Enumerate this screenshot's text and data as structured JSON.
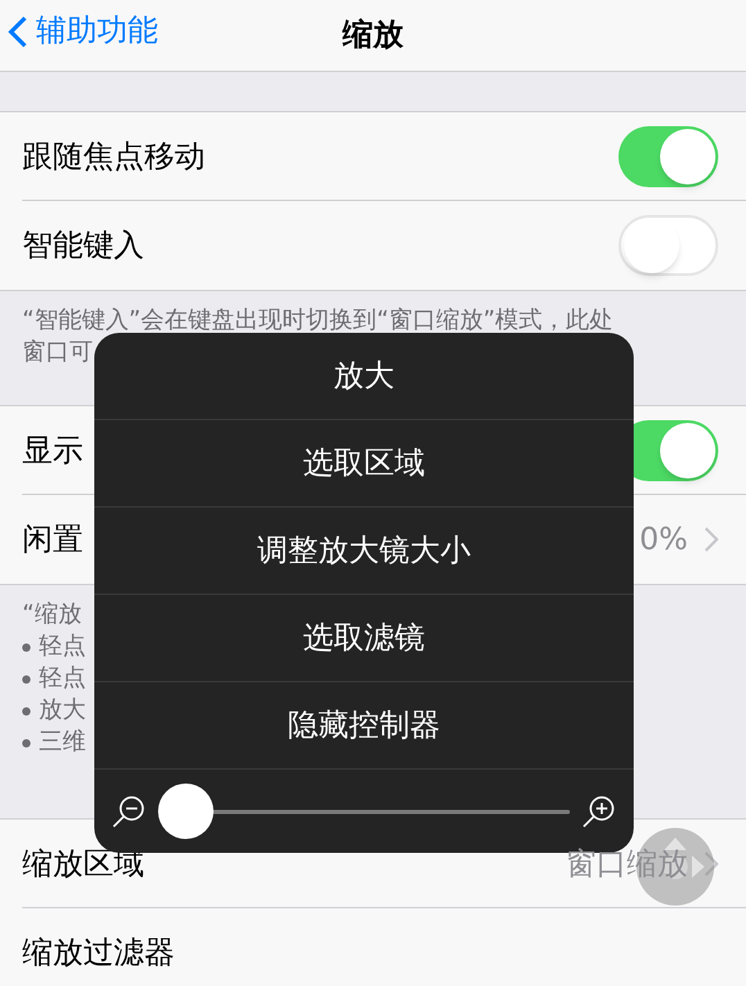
{
  "nav": {
    "back": "辅助功能",
    "title": "缩放"
  },
  "groups": [
    {
      "rows": [
        {
          "kind": "toggle",
          "label": "跟随焦点移动",
          "on": true
        },
        {
          "kind": "toggle",
          "label": "智能键入",
          "on": false
        }
      ],
      "footer": {
        "text": "“智能键入”会在键盘出现时切换到“窗口缩放”模式，此处",
        "lines": [
          "窗口可"
        ]
      }
    },
    {
      "rows": [
        {
          "kind": "toggle",
          "label": "显示",
          "on": true
        },
        {
          "kind": "value",
          "label": "闲置",
          "value": "0%"
        }
      ],
      "footer": {
        "text": "“缩放",
        "bullets": [
          "轻点",
          "轻点",
          "放大",
          "三维"
        ]
      }
    },
    {
      "rows": [
        {
          "kind": "value",
          "label": "缩放区域",
          "value": "窗口缩放"
        },
        {
          "kind": "plain",
          "label": "缩放过滤器"
        }
      ]
    }
  ],
  "menu": {
    "items": [
      "放大",
      "选取区域",
      "调整放大镜大小",
      "选取滤镜",
      "隐藏控制器"
    ],
    "slider": {
      "level": 0
    }
  }
}
